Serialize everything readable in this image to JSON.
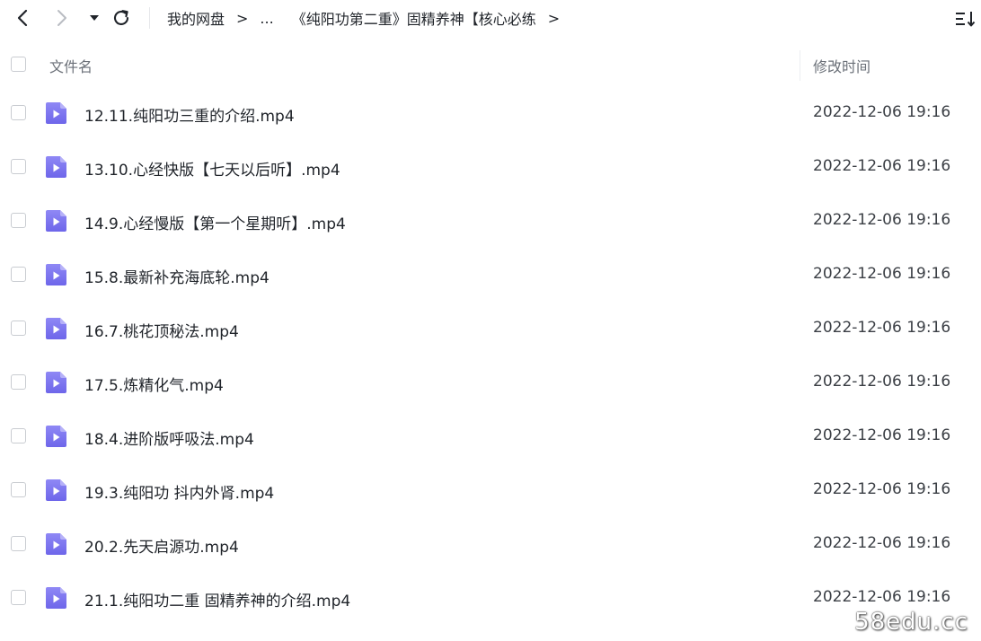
{
  "navbar": {
    "back_icon": "chevron-left-icon",
    "forward_icon": "chevron-right-icon",
    "dropdown_icon": "caret-down-icon",
    "refresh_icon": "refresh-icon",
    "sort_icon": "sort-icon",
    "breadcrumb": {
      "root": "我的网盘",
      "ellipsis": "...",
      "parent": "《纯阳功第二重》固精养神【核心必练",
      "separator": ">"
    }
  },
  "table": {
    "header": {
      "name_label": "文件名",
      "time_label": "修改时间"
    },
    "files": [
      {
        "name": "12.11.纯阳功三重的介绍.mp4",
        "modified": "2022-12-06 19:16"
      },
      {
        "name": "13.10.心经快版【七天以后听】.mp4",
        "modified": "2022-12-06 19:16"
      },
      {
        "name": "14.9.心经慢版【第一个星期听】.mp4",
        "modified": "2022-12-06 19:16"
      },
      {
        "name": "15.8.最新补充海底轮.mp4",
        "modified": "2022-12-06 19:16"
      },
      {
        "name": "16.7.桃花顶秘法.mp4",
        "modified": "2022-12-06 19:16"
      },
      {
        "name": "17.5.炼精化气.mp4",
        "modified": "2022-12-06 19:16"
      },
      {
        "name": "18.4.进阶版呼吸法.mp4",
        "modified": "2022-12-06 19:16"
      },
      {
        "name": "19.3.纯阳功 抖内外肾.mp4",
        "modified": "2022-12-06 19:16"
      },
      {
        "name": "20.2.先天启源功.mp4",
        "modified": "2022-12-06 19:16"
      },
      {
        "name": "21.1.纯阳功二重 固精养神的介绍.mp4",
        "modified": "2022-12-06 19:16"
      }
    ]
  },
  "colors": {
    "icon_purple": "#7b73f0",
    "icon_purple_light": "#a9a3f7",
    "checkbox_border": "#c9ccd1",
    "header_text": "#6b7078"
  },
  "watermark": "58edu.cc"
}
